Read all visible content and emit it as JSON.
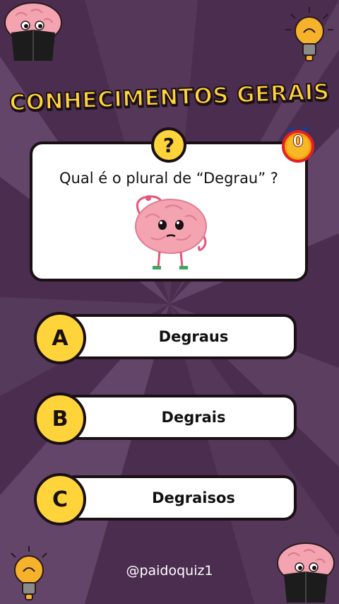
{
  "title": "CONHECIMENTOS GERAIS",
  "question": {
    "badge": "?",
    "text": "Qual é o plural de “Degrau” ?"
  },
  "timer": {
    "value": "0"
  },
  "options": [
    {
      "letter": "A",
      "label": "Degraus"
    },
    {
      "letter": "B",
      "label": "Degrais"
    },
    {
      "letter": "C",
      "label": "Degraisos"
    }
  ],
  "handle": "@paidoquiz1",
  "colors": {
    "accent": "#ffd43a",
    "background": "#4a2c4e",
    "outline": "#1a1014",
    "timer": "#f5a200"
  },
  "icons": [
    "brain-reading-icon",
    "lightbulb-icon",
    "question-icon",
    "stopwatch-icon",
    "brain-character-icon"
  ]
}
